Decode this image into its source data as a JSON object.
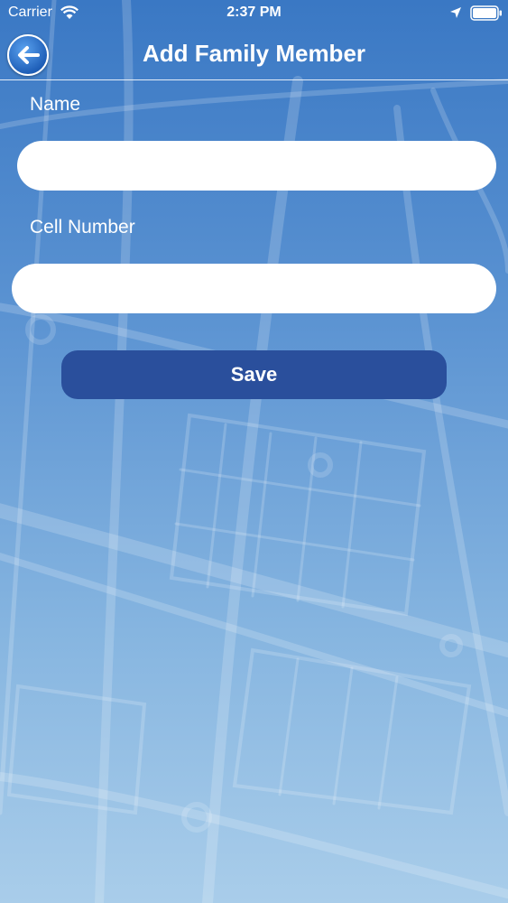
{
  "status_bar": {
    "carrier": "Carrier",
    "time": "2:37 PM",
    "icons": [
      "wifi-icon",
      "location-arrow-icon",
      "battery-icon"
    ]
  },
  "nav": {
    "title": "Add Family Member",
    "back_icon": "arrow-left-icon"
  },
  "form": {
    "name_label": "Name",
    "name_value": "",
    "cell_label": "Cell Number",
    "cell_value": "",
    "save_label": "Save"
  },
  "colors": {
    "background_top": "#3a78c4",
    "background_bottom": "#a9cdea",
    "save_button": "#2a4f9c",
    "input_background": "#ffffff",
    "text": "#ffffff"
  }
}
